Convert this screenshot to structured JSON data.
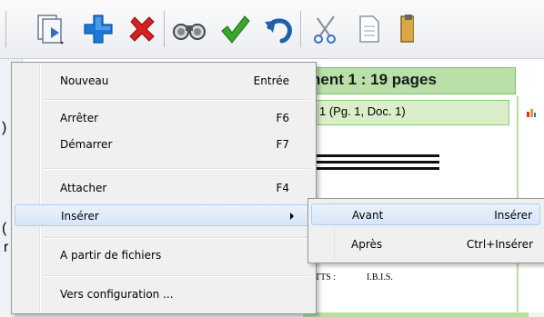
{
  "toolbar": {
    "buttons": [
      {
        "name": "open-document-icon"
      },
      {
        "name": "add-plus-icon"
      },
      {
        "name": "delete-x-icon"
      },
      {
        "name": "binoculars-icon"
      },
      {
        "name": "checkmark-icon"
      },
      {
        "name": "undo-icon"
      },
      {
        "name": "scissors-icon"
      },
      {
        "name": "copy-icon"
      },
      {
        "name": "paste-icon"
      }
    ]
  },
  "background": {
    "title_partial": "nent 1 : 19 pages",
    "subheader_partial": "1 (Pg. 1, Doc. 1)",
    "doc_text_left": "TTS :",
    "doc_text_right": "I.B.I.S.",
    "left_glyph_1": ")",
    "left_glyph_2": "(",
    "left_glyph_3": "r"
  },
  "menu": {
    "items": [
      {
        "label": "Nouveau",
        "shortcut": "Entrée"
      },
      {
        "label": "Arrêter",
        "shortcut": "F6"
      },
      {
        "label": "Démarrer",
        "shortcut": "F7"
      },
      {
        "label": "Attacher",
        "shortcut": "F4"
      },
      {
        "label": "Insérer",
        "shortcut": ""
      },
      {
        "label": "A partir de fichiers",
        "shortcut": ""
      },
      {
        "label": "Vers configuration ...",
        "shortcut": ""
      }
    ]
  },
  "submenu": {
    "items": [
      {
        "label": "Avant",
        "shortcut": "Insérer"
      },
      {
        "label": "Après",
        "shortcut": "Ctrl+Insérer"
      }
    ]
  },
  "colors": {
    "accent_green": "#b8e0a8",
    "highlight_blue": "#d6e6f9",
    "plus_blue": "#1e78d8",
    "delete_red": "#d42020",
    "check_green": "#3aa629"
  }
}
